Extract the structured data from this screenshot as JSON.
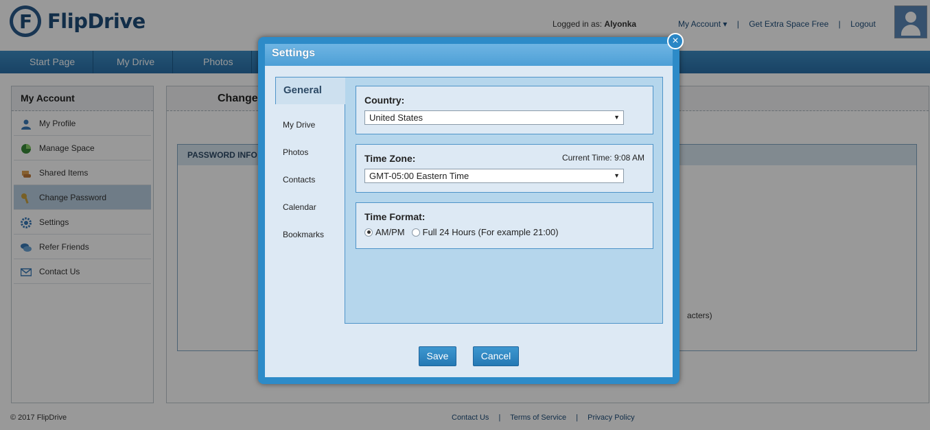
{
  "brand": {
    "name": "FlipDrive"
  },
  "header": {
    "logged_in_label": "Logged in as:",
    "username": "Alyonka",
    "my_account": "My Account",
    "get_extra_space": "Get Extra Space Free",
    "logout": "Logout",
    "separator": "|"
  },
  "nav": {
    "items": [
      "Start Page",
      "My Drive",
      "Photos"
    ]
  },
  "sidebar": {
    "title": "My Account",
    "items": [
      {
        "label": "My Profile",
        "icon": "user-icon"
      },
      {
        "label": "Manage Space",
        "icon": "pie-chart-icon"
      },
      {
        "label": "Shared Items",
        "icon": "shared-hand-icon"
      },
      {
        "label": "Change Password",
        "icon": "key-icon",
        "active": true
      },
      {
        "label": "Settings",
        "icon": "gear-icon"
      },
      {
        "label": "Refer Friends",
        "icon": "chat-bubbles-icon"
      },
      {
        "label": "Contact Us",
        "icon": "envelope-icon"
      }
    ]
  },
  "main": {
    "title": "Change",
    "section_title": "PASSWORD INFO",
    "hint_fragment": "acters)"
  },
  "footer": {
    "copyright": "© 2017 FlipDrive",
    "links": [
      "Contact Us",
      "Terms of Service",
      "Privacy Policy"
    ],
    "separator": "|"
  },
  "modal": {
    "title": "Settings",
    "close_icon": "close-icon",
    "tabs": [
      "General",
      "My Drive",
      "Photos",
      "Contacts",
      "Calendar",
      "Bookmarks"
    ],
    "active_tab": "General",
    "country": {
      "label": "Country:",
      "value": "United States"
    },
    "time_zone": {
      "label": "Time Zone:",
      "current_time": "Current Time: 9:08 AM",
      "value": "GMT-05:00 Eastern Time"
    },
    "time_format": {
      "label": "Time Format:",
      "options": [
        "AM/PM",
        "Full 24 Hours (For example 21:00)"
      ],
      "selected": "AM/PM"
    },
    "buttons": {
      "save": "Save",
      "cancel": "Cancel"
    }
  }
}
